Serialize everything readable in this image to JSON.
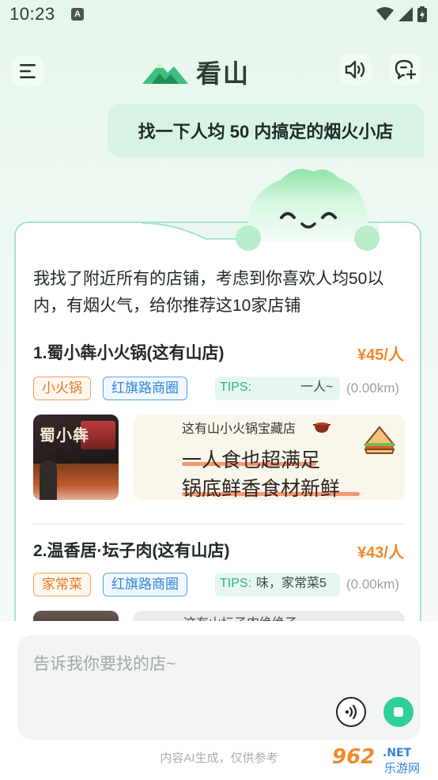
{
  "status_bar": {
    "time": "10:23",
    "notification_icon": "a-letter-icon",
    "a_glyph": "A",
    "icons": [
      "wifi-icon",
      "signal-icon",
      "battery-icon"
    ]
  },
  "header": {
    "app_name": "看山",
    "icons": [
      "menu-icon",
      "speaker-icon",
      "new-chat-icon"
    ]
  },
  "user_message": "找一下人均 50 内搞定的烟火小店",
  "reply": {
    "intro": "我找了附近所有的店铺，考虑到你喜欢人均50以内，有烟火气，给你推荐这10家店铺",
    "items": [
      {
        "title": "1.蜀小犇小火锅(这有山店)",
        "price": "¥45/人",
        "category": "小火锅",
        "area": "红旗路商圈",
        "tips_label": "TIPS:",
        "tips_text": "一人~",
        "distance": "(0.00km)",
        "photo_sign": "蜀小犇",
        "promo_subtitle": "这有山小火锅宝藏店",
        "promo_line1": "一人食也超满足",
        "promo_line2": "锅底鲜香食材新鲜"
      },
      {
        "title": "2.温香居·坛子肉(这有山店)",
        "price": "¥43/人",
        "category": "家常菜",
        "area": "红旗路商圈",
        "tips_label": "TIPS:",
        "tips_text": "味，家常菜5",
        "distance": "(0.00km)",
        "promo_subtitle": "这有山坛子肉绝绝子"
      }
    ]
  },
  "input": {
    "placeholder": "告诉我你要找的店~",
    "icons": [
      "voice-input-icon",
      "stop-icon"
    ]
  },
  "disclaimer": "内容AI生成，仅供参考",
  "watermark": {
    "number": "962",
    "suffix": ".NET",
    "text": "乐游网"
  },
  "colors": {
    "accent_green": "#2fcf9a",
    "price_orange": "#f08a2a",
    "tag_blue": "#2f86d6"
  }
}
